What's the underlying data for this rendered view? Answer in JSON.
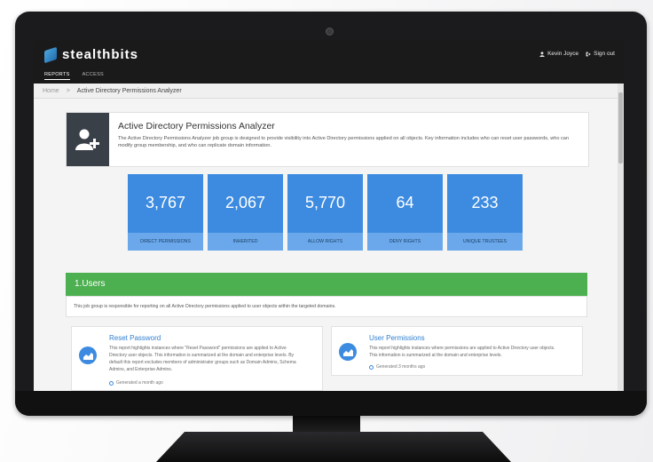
{
  "app": {
    "brand": "stealthbits"
  },
  "user": {
    "name": "Kevin Joyce",
    "signout": "Sign out"
  },
  "nav": {
    "reports": "REPORTS",
    "access": "ACCESS"
  },
  "breadcrumb": {
    "home": "Home",
    "sep": ">",
    "current": "Active Directory Permissions Analyzer"
  },
  "header": {
    "title": "Active Directory Permissions Analyzer",
    "description": "The Active Directory Permissions Analyzer job group is designed to provide visibility into Active Directory permissions applied on all objects. Key information includes who can reset user passwords, who can modify group membership, and who can replicate domain information."
  },
  "tiles": [
    {
      "value": "3,767",
      "label": "DIRECT PERMISSIONS"
    },
    {
      "value": "2,067",
      "label": "INHERITED"
    },
    {
      "value": "5,770",
      "label": "ALLOW RIGHTS"
    },
    {
      "value": "64",
      "label": "DENY RIGHTS"
    },
    {
      "value": "233",
      "label": "UNIQUE TRUSTEES"
    }
  ],
  "section": {
    "title": "1.Users",
    "description": "This job group is responsible for reporting on all Active Directory permissions applied to user objects within the targeted domains."
  },
  "reports": [
    {
      "title": "Reset Password",
      "lines": [
        "This report highlights instances where \"Reset Password\" permissions are applied to Active",
        "Directory user objects. This information is summarized at the domain and enterprise levels. By",
        "default this report excludes members of administrator groups such as Domain Admins, Schema",
        "Admins, and Enterprise Admins."
      ],
      "generated": "Generated a month ago"
    },
    {
      "title": "User Permissions",
      "lines": [
        "This report highlights instances where permissions are applied to Active Directory user objects.",
        "This information is summarized at the domain and enterprise levels."
      ],
      "generated": "Generated 3 months ago"
    }
  ],
  "colors": {
    "tile": "#3d8be0",
    "tile_label": "#6aa8eb",
    "section": "#4caf50",
    "topbar": "#1a1a1a"
  },
  "icons": [
    "user-add-icon",
    "user-icon",
    "signout-icon",
    "chart-icon",
    "clock-icon"
  ]
}
